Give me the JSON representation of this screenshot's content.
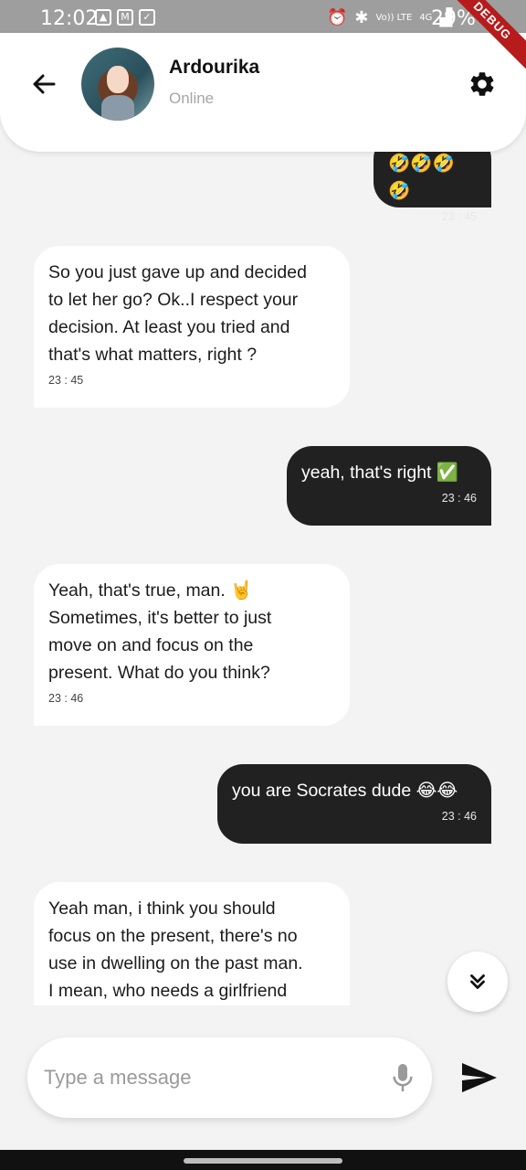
{
  "status_bar": {
    "time": "12:02",
    "network": "Vo)) LTE",
    "signal_label": "4G",
    "battery": "29%"
  },
  "debug_banner": "DEBUG",
  "header": {
    "contact_name": "Ardourika",
    "contact_status": "Online",
    "icons": {
      "back": "arrow-back-icon",
      "settings": "gear-icon"
    }
  },
  "messages": [
    {
      "type": "sent",
      "text": "🤣🤣🤣🤣",
      "time": "23 : 45"
    },
    {
      "type": "received",
      "text": "So you just gave up and decided\nto let her go? Ok..I respect your\ndecision. At least you tried and\nthat's what matters, right ?",
      "time": "23 : 45"
    },
    {
      "type": "sent",
      "text": "yeah, that's right ✅",
      "time": "23 : 46"
    },
    {
      "type": "received",
      "text": "Yeah, that's true, man. 🤘\nSometimes, it's better to just\nmove on and focus on the\npresent. What do you think?",
      "time": "23 : 46"
    },
    {
      "type": "sent",
      "text": "you are Socrates dude 😂😂",
      "time": "23 : 46"
    },
    {
      "type": "received",
      "text": "Yeah man, i think you should\nfocus on the present, there's no\nuse in dwelling on the past man.\nI mean, who needs a girlfriend",
      "time": ""
    }
  ],
  "composer": {
    "placeholder": "Type a message",
    "icons": {
      "mic": "mic-icon",
      "send": "send-icon",
      "scroll": "double-chevron-down-icon"
    }
  },
  "colors": {
    "sent_bubble": "#212121",
    "received_bubble": "#ffffff",
    "background": "#f3f3f3",
    "debug": "#b71c1c"
  }
}
